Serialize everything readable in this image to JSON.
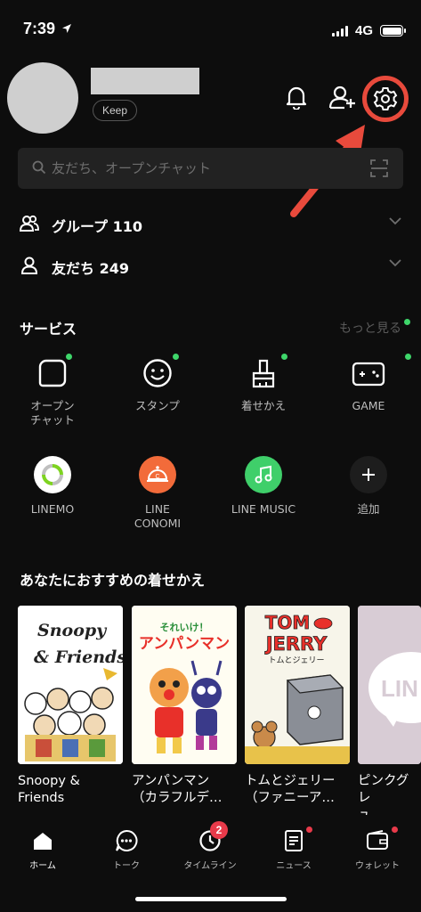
{
  "status_bar": {
    "time": "7:39",
    "network": "4G"
  },
  "profile": {
    "keep_label": "Keep"
  },
  "header_icons": {
    "bell": "bell-icon",
    "add_friend": "add-friend-icon",
    "settings": "gear-icon"
  },
  "annotation": {
    "color": "#e84a3c"
  },
  "search": {
    "placeholder": "友だち、オープンチャット"
  },
  "lists": {
    "groups": {
      "label": "グループ 110"
    },
    "friends": {
      "label": "友だち 249"
    }
  },
  "services": {
    "title": "サービス",
    "more": "もっと見る",
    "items": [
      {
        "label": "オープン\nチャット",
        "icon": "open-chat-icon",
        "new": true
      },
      {
        "label": "スタンプ",
        "icon": "sticker-icon",
        "new": true
      },
      {
        "label": "着せかえ",
        "icon": "theme-brush-icon",
        "new": true
      },
      {
        "label": "GAME",
        "icon": "game-icon",
        "new": true
      },
      {
        "label": "LINEMO",
        "icon": "linemo-icon",
        "new": false
      },
      {
        "label": "LINE\nCONOMI",
        "icon": "conomi-icon",
        "new": false
      },
      {
        "label": "LINE MUSIC",
        "icon": "music-icon",
        "new": false
      },
      {
        "label": "追加",
        "icon": "plus-icon",
        "new": false
      }
    ]
  },
  "themes": {
    "title": "あなたにおすすめの着せかえ",
    "items": [
      {
        "label": "Snoopy &\nFriends",
        "art": "Snoopy\n& Friends"
      },
      {
        "label": "アンパンマン\n（カラフルデ…",
        "art": "アンパンマン"
      },
      {
        "label": "トムとジェリー\n（ファニーア…",
        "art": "TOM and JERRY"
      },
      {
        "label": "ピンクグレ\nュ",
        "art": "LINE"
      }
    ]
  },
  "bottom_nav": {
    "items": [
      {
        "label": "ホーム",
        "icon": "home-icon",
        "active": true
      },
      {
        "label": "トーク",
        "icon": "chat-icon",
        "active": false
      },
      {
        "label": "タイムライン",
        "icon": "timeline-clock-icon",
        "badge": "2"
      },
      {
        "label": "ニュース",
        "icon": "news-icon",
        "dot": true
      },
      {
        "label": "ウォレット",
        "icon": "wallet-icon",
        "dot": true
      }
    ]
  }
}
